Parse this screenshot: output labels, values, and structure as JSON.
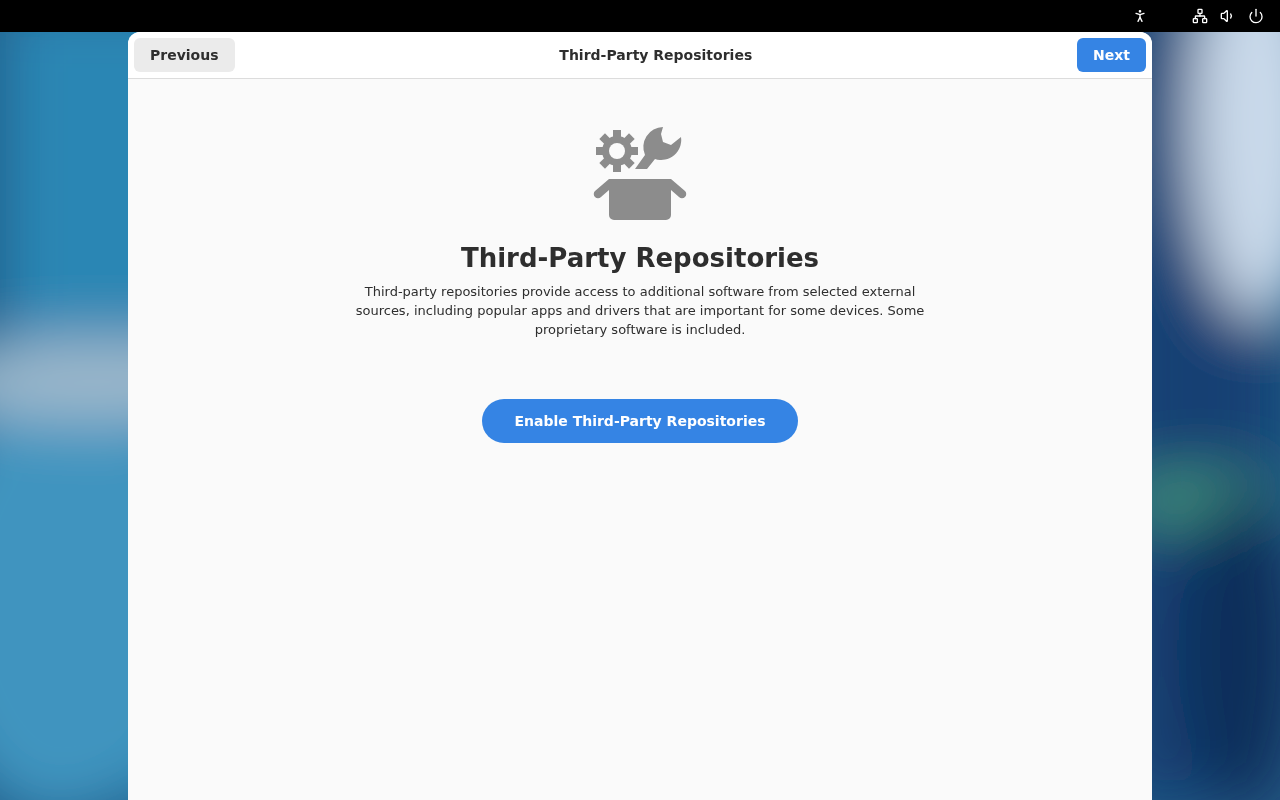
{
  "header": {
    "previous": "Previous",
    "title": "Third-Party Repositories",
    "next": "Next"
  },
  "page": {
    "heading": "Third-Party Repositories",
    "description": "Third-party repositories provide access to additional software from selected external sources, including popular apps and drivers that are important for some devices. Some proprietary software is included.",
    "button": "Enable Third-Party Repositories"
  }
}
